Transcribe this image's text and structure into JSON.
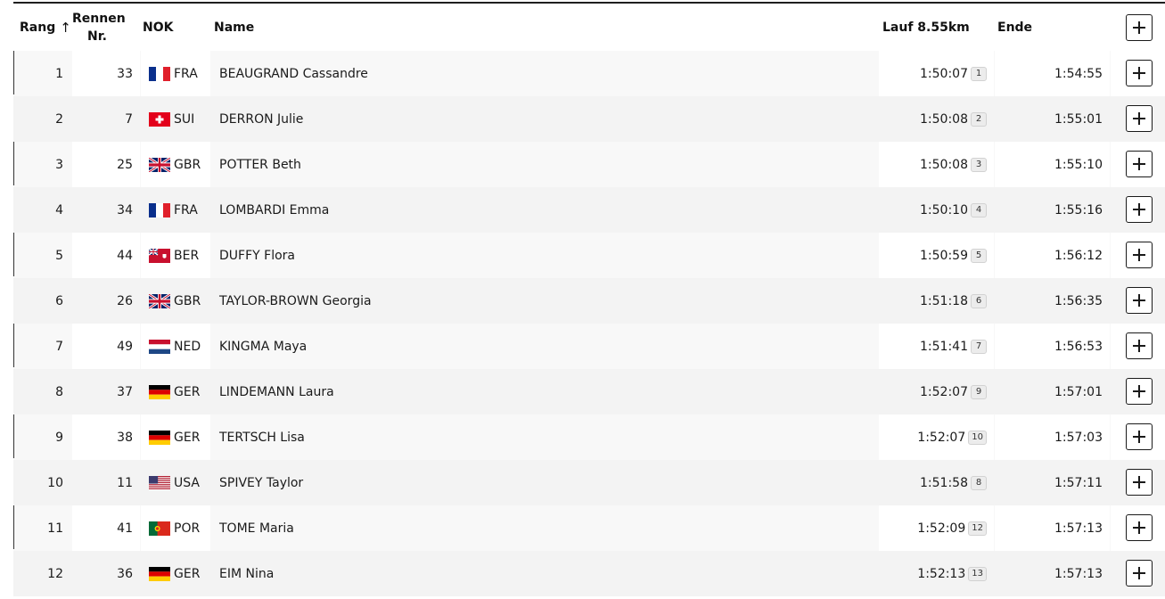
{
  "header": {
    "rang": "Rang",
    "bib_line1": "Rennen",
    "bib_line2": "Nr.",
    "nok": "NOK",
    "name": "Name",
    "run": "Lauf 8.55km",
    "end": "Ende"
  },
  "rows": [
    {
      "rank": "1",
      "bib": "33",
      "noc": "FRA",
      "name": "BEAUGRAND Cassandre",
      "run": "1:50:07",
      "run_rank": "1",
      "end": "1:54:55"
    },
    {
      "rank": "2",
      "bib": "7",
      "noc": "SUI",
      "name": "DERRON Julie",
      "run": "1:50:08",
      "run_rank": "2",
      "end": "1:55:01"
    },
    {
      "rank": "3",
      "bib": "25",
      "noc": "GBR",
      "name": "POTTER Beth",
      "run": "1:50:08",
      "run_rank": "3",
      "end": "1:55:10"
    },
    {
      "rank": "4",
      "bib": "34",
      "noc": "FRA",
      "name": "LOMBARDI Emma",
      "run": "1:50:10",
      "run_rank": "4",
      "end": "1:55:16"
    },
    {
      "rank": "5",
      "bib": "44",
      "noc": "BER",
      "name": "DUFFY Flora",
      "run": "1:50:59",
      "run_rank": "5",
      "end": "1:56:12"
    },
    {
      "rank": "6",
      "bib": "26",
      "noc": "GBR",
      "name": "TAYLOR-BROWN Georgia",
      "run": "1:51:18",
      "run_rank": "6",
      "end": "1:56:35"
    },
    {
      "rank": "7",
      "bib": "49",
      "noc": "NED",
      "name": "KINGMA Maya",
      "run": "1:51:41",
      "run_rank": "7",
      "end": "1:56:53"
    },
    {
      "rank": "8",
      "bib": "37",
      "noc": "GER",
      "name": "LINDEMANN Laura",
      "run": "1:52:07",
      "run_rank": "9",
      "end": "1:57:01"
    },
    {
      "rank": "9",
      "bib": "38",
      "noc": "GER",
      "name": "TERTSCH Lisa",
      "run": "1:52:07",
      "run_rank": "10",
      "end": "1:57:03"
    },
    {
      "rank": "10",
      "bib": "11",
      "noc": "USA",
      "name": "SPIVEY Taylor",
      "run": "1:51:58",
      "run_rank": "8",
      "end": "1:57:11"
    },
    {
      "rank": "11",
      "bib": "41",
      "noc": "POR",
      "name": "TOME Maria",
      "run": "1:52:09",
      "run_rank": "12",
      "end": "1:57:13"
    },
    {
      "rank": "12",
      "bib": "36",
      "noc": "GER",
      "name": "EIM Nina",
      "run": "1:52:13",
      "run_rank": "13",
      "end": "1:57:13"
    }
  ],
  "icons": {
    "sort": "arrow-up-icon",
    "expand": "plus-icon"
  },
  "colors": {
    "header_line": "#1f1f1f",
    "row_bg_alt": "#f3f3f3",
    "badge_bg": "#ececec"
  }
}
